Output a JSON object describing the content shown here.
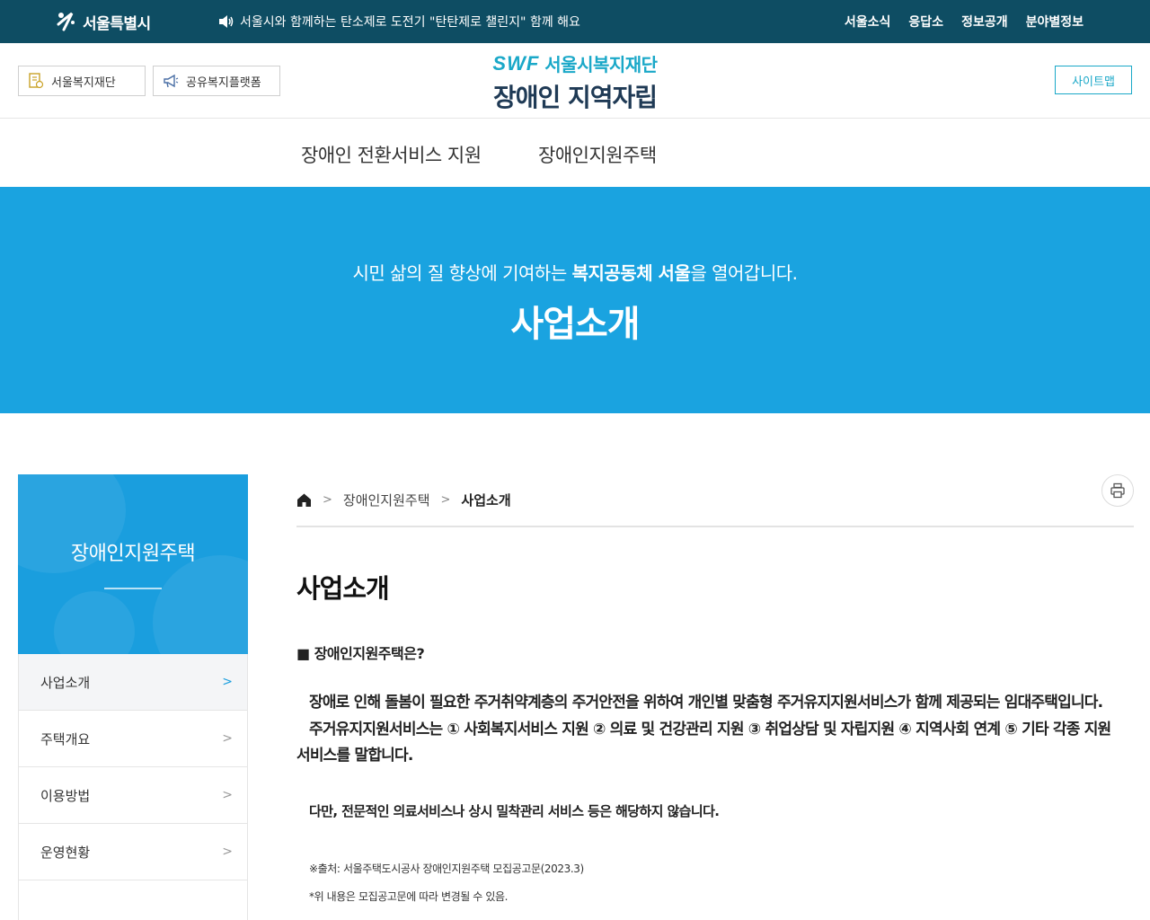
{
  "topbar": {
    "city_logo": "서울특별시",
    "notice": "서울시와 함께하는 탄소제로 도전기 \"탄탄제로 챌린지\" 함께 해요",
    "links": [
      "서울소식",
      "응답소",
      "정보공개",
      "분야별정보"
    ]
  },
  "header": {
    "btn_foundation": "서울복지재단",
    "btn_platform": "공유복지플랫폼",
    "brand_mark": "SWF",
    "brand_org": "서울시복지재단",
    "brand_title": "장애인 지역자립",
    "sitemap": "사이트맵"
  },
  "nav": {
    "items": [
      "장애인 전환서비스 지원",
      "장애인지원주택"
    ]
  },
  "banner": {
    "slogan_pre": "시민 삶의 질 향상에 기여하는 ",
    "slogan_bold": "복지공동체 서울",
    "slogan_post": "을 열어갑니다.",
    "title": "사업소개"
  },
  "sidebar": {
    "title": "장애인지원주택",
    "items": [
      {
        "label": "사업소개"
      },
      {
        "label": "주택개요"
      },
      {
        "label": "이용방법"
      },
      {
        "label": "운영현황"
      }
    ]
  },
  "breadcrumb": {
    "level1": "장애인지원주택",
    "current": "사업소개"
  },
  "content": {
    "title": "사업소개",
    "section_heading": "■ 장애인지원주택은?",
    "para1": "장애로 인해 돌봄이 필요한 주거취약계층의 주거안전을 위하여 개인별 맞춤형 주거유지지원서비스가 함께 제공되는 임대주택입니다.",
    "para2_line1": "주거유지지원서비스는 ① 사회복지서비스 지원 ② 의료 및 건강관리 지원 ③ 취업상담 및 자립지원 ④ 지역사회 연계 ⑤ 기타 각종 지원",
    "para2_line2": "서비스를 말합니다.",
    "note": "다만, 전문적인 의료서비스나 상시 밀착관리 서비스 등은 해당하지 않습니다.",
    "source": "※출처: 서울주택도시공사 장애인지원주택 모집공고문(2023.3)",
    "disclaimer": "*위 내용은 모집공고문에 따라 변경될 수 있음."
  },
  "colors": {
    "topbar": "#0e4d63",
    "accent": "#1aa8c8",
    "banner": "#1aa3e0",
    "brand_title": "#1f3a55"
  },
  "icons": [
    "seoul-logo-icon",
    "speaker-icon",
    "document-icon",
    "megaphone-icon",
    "home-icon",
    "chevron-right-icon",
    "print-icon"
  ]
}
